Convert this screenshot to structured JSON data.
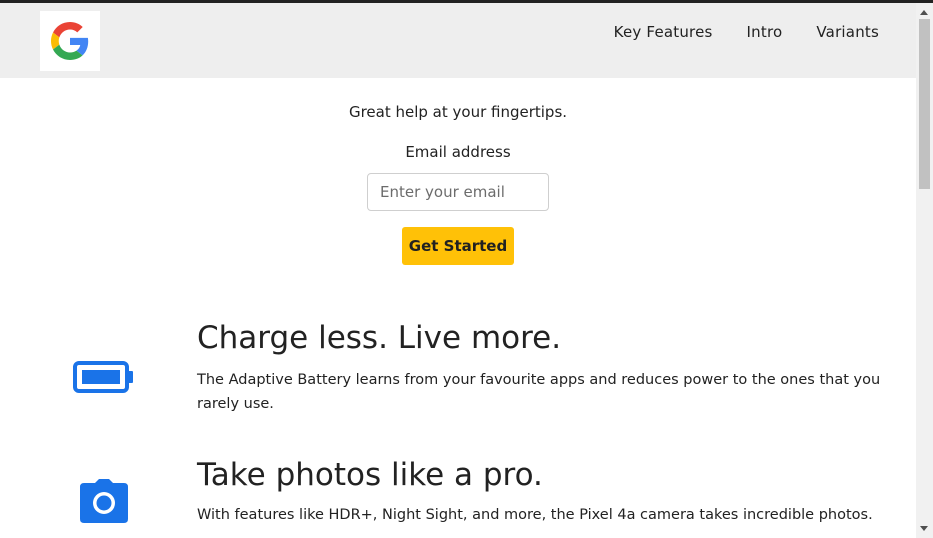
{
  "header": {
    "logo_icon": "google-g-logo",
    "nav": [
      {
        "label": "Key Features"
      },
      {
        "label": "Intro"
      },
      {
        "label": "Variants"
      }
    ]
  },
  "hero": {
    "tagline": "Great help at your fingertips.",
    "email_label": "Email address",
    "email_placeholder": "Enter your email",
    "cta_label": "Get Started"
  },
  "features": [
    {
      "icon": "battery-icon",
      "title": "Charge less. Live more.",
      "text": "The Adaptive Battery learns from your favourite apps and reduces power to the ones that you rarely use."
    },
    {
      "icon": "camera-icon",
      "title": "Take photos like a pro.",
      "text": "With features like HDR+, Night Sight, and more, the Pixel 4a camera takes incredible photos."
    }
  ],
  "colors": {
    "accent_blue": "#1a73e8",
    "cta_yellow": "#ffc107",
    "header_bg": "#eeeeee"
  }
}
